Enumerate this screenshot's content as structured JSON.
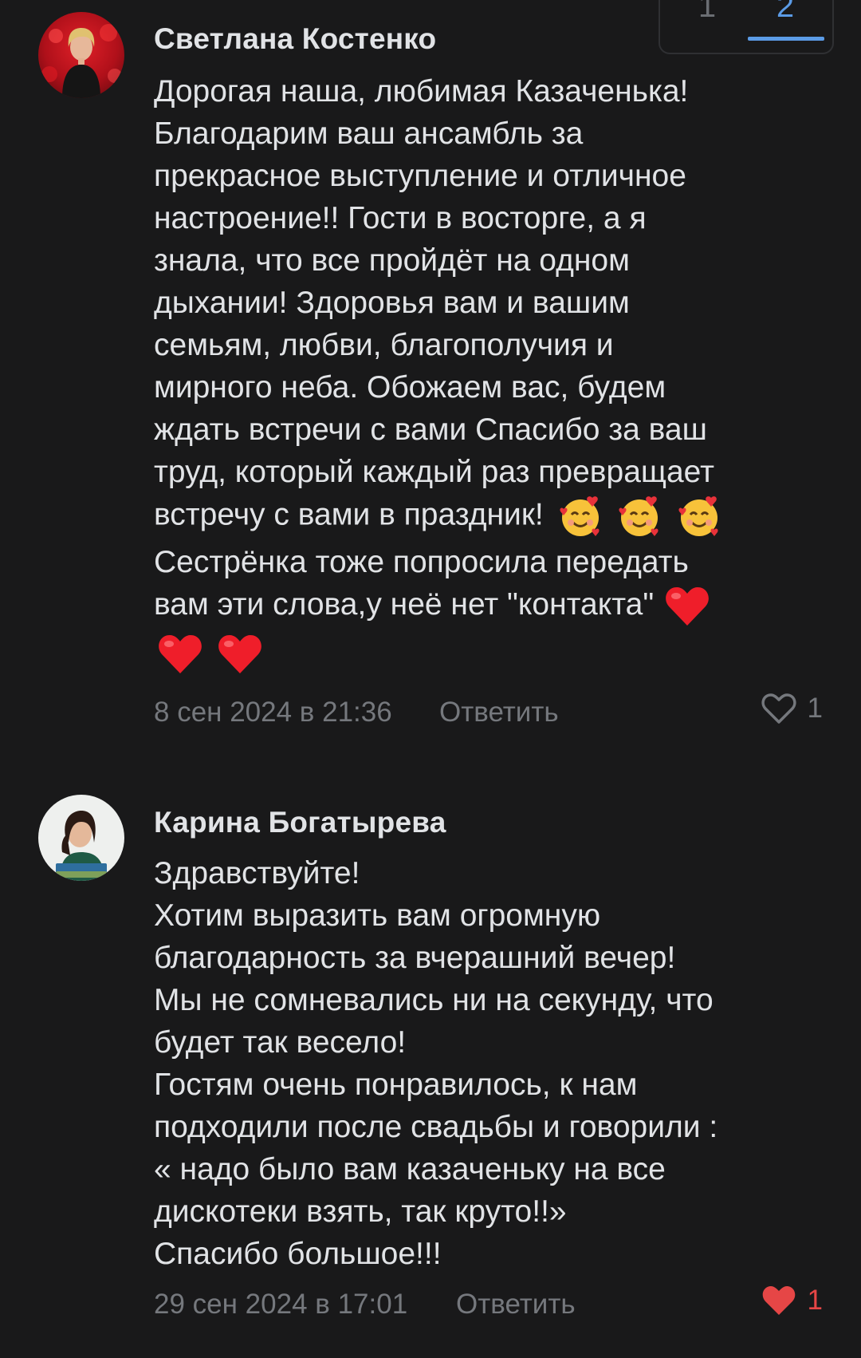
{
  "pagination": {
    "tabs": [
      "1",
      "2"
    ],
    "active_tab": "2",
    "accent_color": "#5b9be6"
  },
  "comments": [
    {
      "author": "Светлана Костенко",
      "avatar": "avatar-photo-red-background",
      "text_lines": [
        "Дорогая наша, любимая Казаченька!",
        "Благодарим ваш ансамбль за",
        "прекрасное выступление и отличное",
        "настроение!! Гости в восторге, а я",
        "знала, что все пройдёт на одном",
        "дыхании! Здоровья вам и вашим",
        "семьям, любви, благополучия и",
        "мирного неба. Обожаем вас, будем",
        "ждать встречи с вами Спасибо за ваш",
        "труд, который каждый раз превращает",
        "встречу с вами в праздник!",
        "Сестрёнка тоже попросила передать",
        "вам эти слова,у неё нет \"контакта\""
      ],
      "emojis": {
        "after_line_11": [
          "smiling-face-with-hearts",
          "smiling-face-with-hearts",
          "smiling-face-with-hearts"
        ],
        "after_line_13": [
          "red-heart"
        ],
        "own_line": [
          "red-heart",
          "red-heart"
        ]
      },
      "date": "8 сен 2024 в 21:36",
      "reply_label": "Ответить",
      "like_count": "1",
      "liked": false
    },
    {
      "author": "Карина Богатырева",
      "avatar": "avatar-photo-light-background",
      "text_lines": [
        "Здравствуйте!",
        "Хотим выразить вам огромную",
        "благодарность за вчерашний вечер!",
        "Мы не сомневались ни на секунду, что",
        "будет так весело!",
        "Гостям очень понравилось, к нам",
        "подходили после свадьбы и говорили :",
        "« надо было вам казаченьку на все",
        "дискотеки взять, так круто!!»",
        "Спасибо большое!!!"
      ],
      "date": "29 сен 2024 в 17:01",
      "reply_label": "Ответить",
      "like_count": "1",
      "liked": true
    }
  ],
  "colors": {
    "background": "#19191a",
    "text": "#e1e3e6",
    "meta": "#75787d",
    "like_active": "#e64646"
  }
}
